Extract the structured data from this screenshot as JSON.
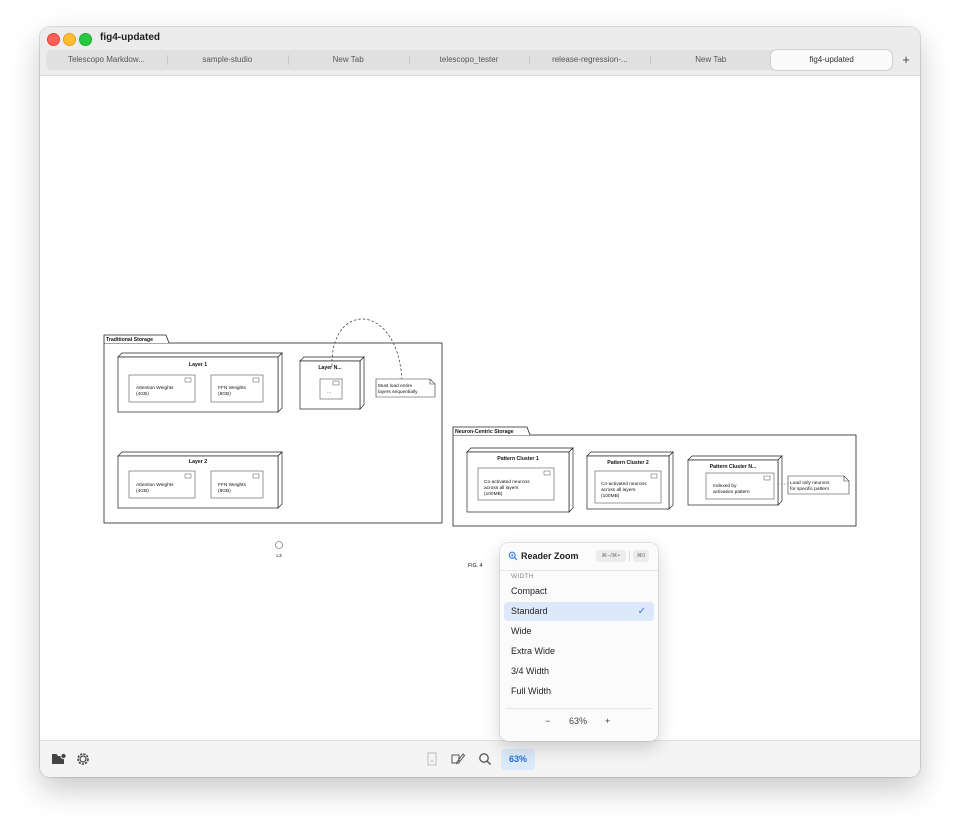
{
  "window": {
    "title": "fig4-updated"
  },
  "tabs": [
    {
      "label": "Telescopo Markdow..."
    },
    {
      "label": "sample-studio"
    },
    {
      "label": "New Tab"
    },
    {
      "label": "telescopo_tester"
    },
    {
      "label": "release-regression-..."
    },
    {
      "label": "New Tab"
    },
    {
      "label": "fig4-updated",
      "active": true
    }
  ],
  "new_tab_label": "+",
  "diagram": {
    "traditional": {
      "package_label": "Traditional Storage",
      "layer1": {
        "title": "Layer 1",
        "attn_line1": "Attention Weights",
        "attn_line2": "(4GB)",
        "ffn_line1": "FFN Weights",
        "ffn_line2": "(8GB)"
      },
      "layer2": {
        "title": "Layer 2",
        "attn_line1": "Attention Weights",
        "attn_line2": "(4GB)",
        "ffn_line1": "FFN Weights",
        "ffn_line2": "(8GB)"
      },
      "layerN": {
        "title": "Layer N...",
        "inner": "..."
      },
      "note_line1": "Must load entire",
      "note_line2": "layers sequentially"
    },
    "neuron": {
      "package_label": "Neuron-Centric Storage",
      "cluster1": {
        "title": "Pattern Cluster 1",
        "line1": "Co-activated neurons",
        "line2": "across all layers",
        "line3": "(100MB)"
      },
      "cluster2": {
        "title": "Pattern Cluster 2",
        "line1": "Co-activated neurons",
        "line2": "across all layers",
        "line3": "(100MB)"
      },
      "clusterN": {
        "title": "Pattern Cluster N...",
        "line1": "Indexed by",
        "line2": "activation pattern"
      },
      "note_line1": "Load only neurons",
      "note_line2": "for specific pattern"
    },
    "marker_label": "L3",
    "fig_caption": "FIG. 4"
  },
  "reader_zoom": {
    "title": "Reader Zoom",
    "shortcut": "⌘−/⌘+",
    "reset_shortcut": "⌘0",
    "section": "WIDTH",
    "options": [
      "Compact",
      "Standard",
      "Wide",
      "Extra Wide",
      "3/4 Width",
      "Full Width"
    ],
    "selected": "Standard",
    "check": "✓",
    "minus": "−",
    "plus": "+",
    "zoom_value": "63%"
  },
  "bottombar": {
    "zoom_chip": "63%"
  },
  "colors": {
    "accent": "#2f7ae5",
    "selected_bg": "#dde9fb"
  }
}
